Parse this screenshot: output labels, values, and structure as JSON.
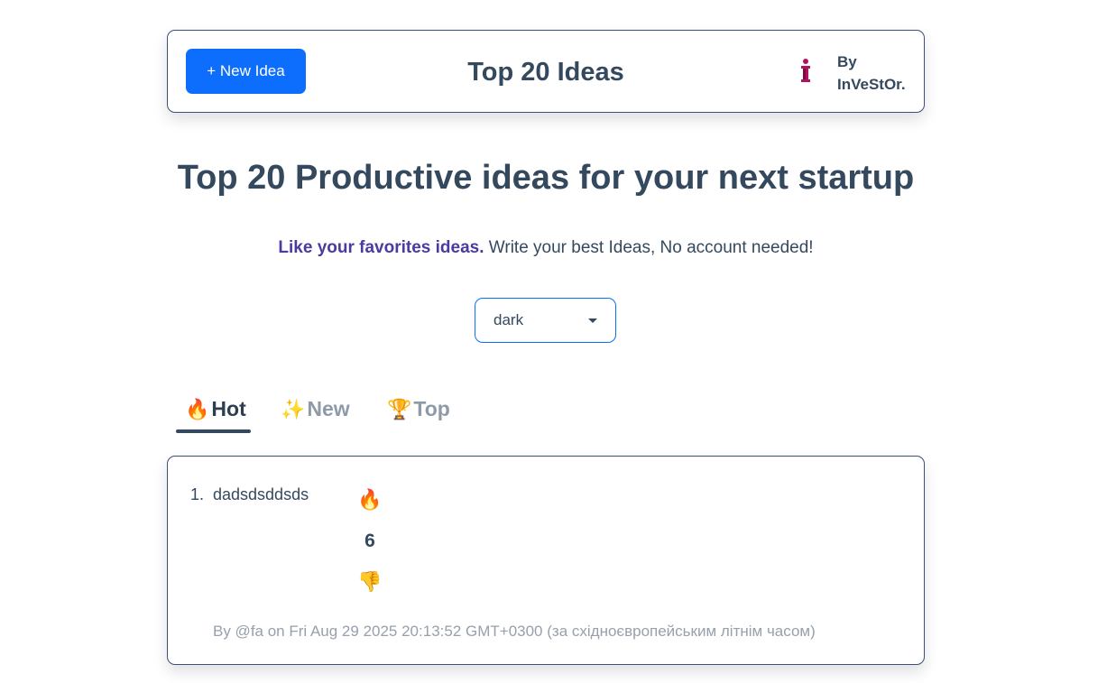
{
  "header": {
    "new_idea_label": "+ New Idea",
    "title": "Top 20 Ideas",
    "byline": "By InVeStOr.",
    "logo_icon": "investor-logo-icon"
  },
  "main": {
    "title": "Top 20 Productive ideas for your next startup",
    "subtitle_strong": "Like your favorites ideas.",
    "subtitle_rest": " Write your best Ideas, No account needed!"
  },
  "theme_select": {
    "selected": "dark"
  },
  "tabs": [
    {
      "emoji": "🔥",
      "label": "Hot",
      "active": true
    },
    {
      "emoji": "✨",
      "label": "New",
      "active": false
    },
    {
      "emoji": "🏆",
      "label": "Top",
      "active": false
    }
  ],
  "ideas": [
    {
      "number": "1.",
      "text": "dadsdsddsds",
      "upvote_emoji": "🔥",
      "votes": "6",
      "downvote_emoji": "👎",
      "meta": "By @fa on Fri Aug 29 2025 20:13:52 GMT+0300 (за східноєвропейським літнім часом)"
    }
  ],
  "colors": {
    "accent": "#0d6efd",
    "text": "#34495e",
    "subtitle_strong": "#4b3aa0",
    "muted": "#97a0ac"
  }
}
